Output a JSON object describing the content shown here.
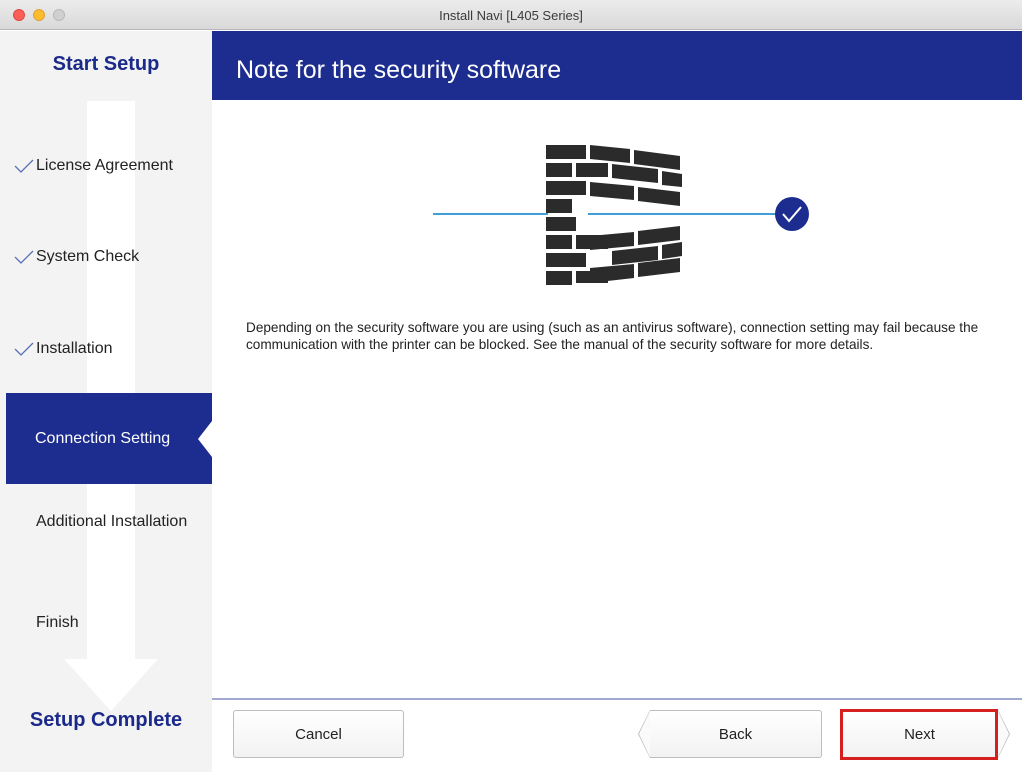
{
  "window": {
    "title": "Install Navi [L405 Series]",
    "controls": [
      "close",
      "minimize",
      "zoom"
    ]
  },
  "sidebar": {
    "start_label": "Start Setup",
    "end_label": "Setup Complete",
    "steps": [
      {
        "label": "License Agreement",
        "state": "done"
      },
      {
        "label": "System Check",
        "state": "done"
      },
      {
        "label": "Installation",
        "state": "done"
      },
      {
        "label": "Connection Setting",
        "state": "current"
      },
      {
        "label": "Additional Installation",
        "state": "pending"
      },
      {
        "label": "Finish",
        "state": "pending"
      }
    ]
  },
  "main": {
    "title": "Note for the security software",
    "illustration": "firewall-icon",
    "message": "Depending on the security software you are using (such as an antivirus software), connection setting may fail because the communication with the printer can be blocked. See the manual of the security software for more details."
  },
  "footer": {
    "cancel_label": "Cancel",
    "back_label": "Back",
    "next_label": "Next"
  },
  "colors": {
    "brand": "#1c2d8f",
    "highlight": "#d62020",
    "connection_line": "#3f9fd6"
  }
}
